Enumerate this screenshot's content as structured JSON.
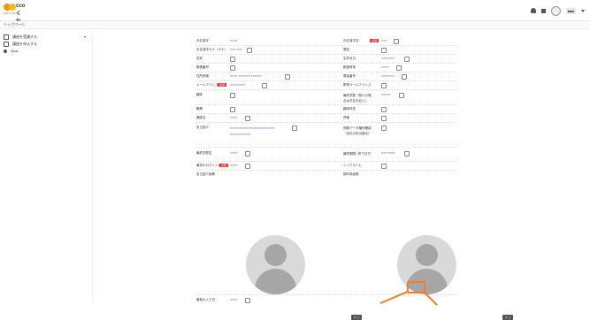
{
  "header": {
    "logo_text": "ccoくれ",
    "logo_sub": "@ROUNEXT",
    "user_name": "■■■",
    "user_link": "個人のアカウント設定はこちら"
  },
  "breadcrumb": "トップページ",
  "sidebar": {
    "items": [
      {
        "label": "講座を受講する",
        "icon": "book-icon"
      },
      {
        "label": "講座を申込する",
        "icon": "cart-icon"
      },
      {
        "label": "Q&A",
        "icon": "question-icon"
      }
    ]
  },
  "profile": {
    "left": [
      {
        "label": "氏名漢字",
        "value": "■■■■"
      },
      {
        "label": "氏名漢字カナ（カナ）",
        "value": "■■■ ■■■"
      },
      {
        "label": "性別",
        "value": ""
      },
      {
        "label": "郵便番号",
        "value": ""
      },
      {
        "label": "住所詳細",
        "value": "■■■■ ■■■■■■ ■■■■■■"
      },
      {
        "label": "メールアドレス",
        "value": "■■■■■■■■",
        "required": "必須"
      },
      {
        "label": "趣味",
        "value": ""
      },
      {
        "label": "職業",
        "value": ""
      },
      {
        "label": "講座名",
        "value": "■■■■"
      },
      {
        "label": "自己紹介",
        "value": "■■■■■■■■■■■■■■■■■■■■■■■■ ■■■■■■■■■■■"
      },
      {
        "label": "最終学歴名",
        "value": "■■■■"
      },
      {
        "label": "最初のログイン日",
        "value": "■■■■",
        "required": "必須"
      },
      {
        "label": "自己紹介画像",
        "value": ""
      },
      {
        "label": "最新の入力日",
        "value": "■■■■"
      }
    ],
    "right": [
      {
        "label": "氏名漢字名",
        "value": "■■■",
        "required": "必須"
      },
      {
        "label": "電話",
        "value": ""
      },
      {
        "label": "生年月日",
        "value": "■■■■■■■"
      },
      {
        "label": "都道府県",
        "value": "■■■■"
      },
      {
        "label": "電話番号",
        "value": "■■■■■■■"
      },
      {
        "label": "携帯メールアドレス",
        "value": ""
      },
      {
        "label": "最終学歴（個人の場合は氏名を記入）",
        "value": "■■■■■"
      },
      {
        "label": "趣味特技",
        "value": ""
      },
      {
        "label": "資格",
        "value": ""
      },
      {
        "label": "勤務データ種別確認（自社の担当者名）",
        "value": ""
      },
      {
        "label": "最終期限 / 終了日付",
        "value": "■■■ ■■■■"
      },
      {
        "label": "ニックネーム",
        "value": ""
      },
      {
        "label": "顔写真画像",
        "value": ""
      }
    ]
  }
}
